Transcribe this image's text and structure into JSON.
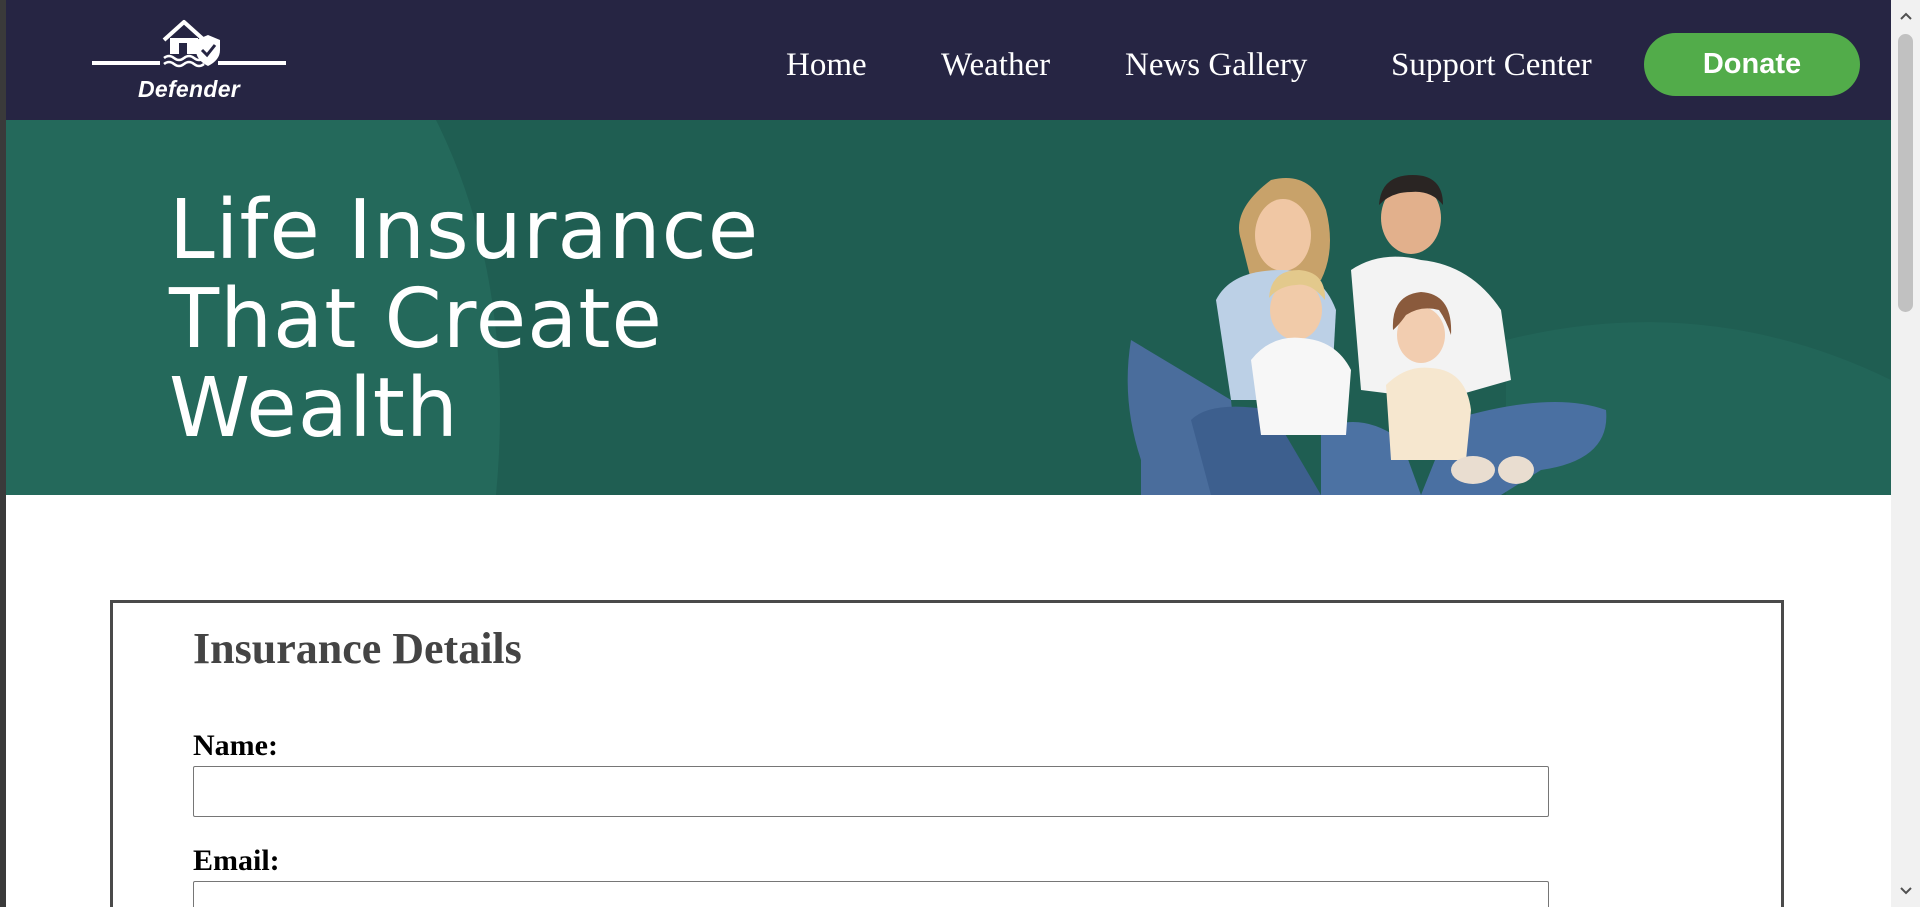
{
  "brand": {
    "name": "Defender",
    "logo_icon": "house-shield-icon"
  },
  "nav": {
    "items": [
      {
        "label": "Home"
      },
      {
        "label": "Weather"
      },
      {
        "label": "News Gallery"
      },
      {
        "label": "Support Center"
      }
    ],
    "donate_label": "Donate"
  },
  "hero": {
    "title_lines": [
      "Life Insurance",
      "That Create",
      "Wealth"
    ],
    "image": "family-photo"
  },
  "form": {
    "title": "Insurance Details",
    "fields": [
      {
        "label": "Name:",
        "value": "",
        "placeholder": ""
      },
      {
        "label": "Email:",
        "value": "",
        "placeholder": ""
      }
    ]
  },
  "colors": {
    "header_bg": "#262543",
    "hero_bg": "#1f5e52",
    "donate_bg": "#52ac4a",
    "text_white": "#ffffff"
  }
}
